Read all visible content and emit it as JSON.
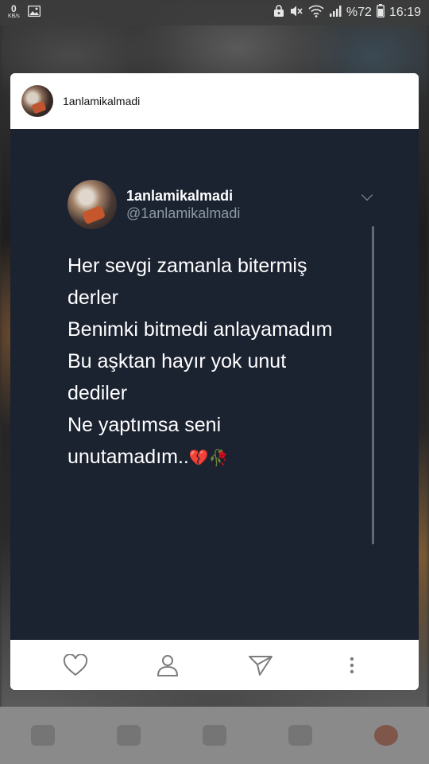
{
  "status_bar": {
    "net_speed": "0",
    "net_unit": "KB/s",
    "battery_percent": "%72",
    "time": "16:19"
  },
  "post": {
    "username": "1anlamikalmadi",
    "tweet": {
      "display_name": "1anlamikalmadi",
      "handle": "@1anlamikalmadi",
      "lines": [
        "Her sevgi zamanla bitermiş",
        "derler",
        "Benimki bitmedi anlayamadım",
        "Bu aşktan hayır yok unut",
        "dediler",
        "Ne yaptımsa seni",
        "unutamadım.."
      ],
      "emojis": [
        "💔",
        "🥀"
      ]
    }
  },
  "icons": {
    "status_left": [
      "image-icon"
    ],
    "status_right": [
      "lock-icon",
      "mute-icon",
      "wifi-icon",
      "signal-icon",
      "battery-icon"
    ],
    "actions": [
      "heart-icon",
      "profile-icon",
      "send-icon",
      "more-icon"
    ]
  }
}
